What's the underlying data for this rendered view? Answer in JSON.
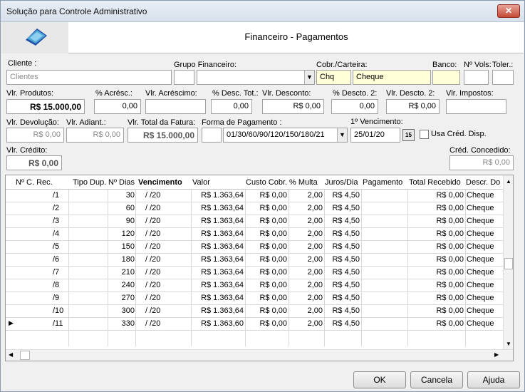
{
  "window": {
    "title": "Solução para Controle Administrativo",
    "close_icon": "close-icon"
  },
  "header": {
    "title": "Financeiro - Pagamentos"
  },
  "form": {
    "cliente_label": "Cliente :",
    "cliente_value": "Clientes",
    "grupo_label": "Grupo Financeiro:",
    "grupo_code": "",
    "grupo_value": "",
    "cobr_label": "Cobr./Carteira:",
    "cobr_code": "Chq",
    "cobr_value": "Cheque",
    "banco_label": "Banco:",
    "banco_value": "",
    "nvols_label": "Nº Vols:",
    "nvols_value": "",
    "toler_label": "Toler.:",
    "toler_value": "",
    "vlr_produtos_label": "Vlr. Produtos:",
    "vlr_produtos_value": "R$ 15.000,00",
    "acresc_pct_label": "% Acrésc.:",
    "acresc_pct_value": "0,00",
    "vlr_acrescimo_label": "Vlr. Acréscimo:",
    "vlr_acrescimo_value": "",
    "desc_tot_pct_label": "% Desc. Tot.:",
    "desc_tot_pct_value": "0,00",
    "vlr_desconto_label": "Vlr. Desconto:",
    "vlr_desconto_value": "R$ 0,00",
    "descto2_pct_label": "% Descto. 2:",
    "descto2_pct_value": "0,00",
    "vlr_descto2_label": "Vlr. Descto. 2:",
    "vlr_descto2_value": "R$ 0,00",
    "vlr_impostos_label": "Vlr. Impostos:",
    "vlr_impostos_value": "",
    "vlr_devolucao_label": "Vlr. Devolução:",
    "vlr_devolucao_value": "R$ 0,00",
    "vlr_adiant_label": "Vlr. Adiant.:",
    "vlr_adiant_value": "R$ 0,00",
    "vlr_total_label": "Vlr. Total da Fatura:",
    "vlr_total_value": "R$ 15.000,00",
    "forma_pgto_label": "Forma de Pagamento :",
    "forma_pgto_code": "",
    "forma_pgto_value": "01/30/60/90/120/150/180/21",
    "primeiro_venc_label": "1º Vencimento:",
    "primeiro_venc_value": "25/01/20",
    "calendar_label": "15",
    "usa_cred_label": "Usa Créd. Disp.",
    "vlr_credito_label": "Vlr. Crédito:",
    "vlr_credito_value": "R$ 0,00",
    "cred_concedido_label": "Créd. Concedido:",
    "cred_concedido_value": "R$ 0,00"
  },
  "grid": {
    "columns": [
      "Nº C. Rec.",
      "Tipo Dup.",
      "Nº Dias",
      "Vencimento",
      "Valor",
      "Custo Cobr.",
      "% Multa",
      "Juros/Dia",
      "Pagamento",
      "Total Recebido",
      "Descr. Do"
    ],
    "rows": [
      {
        "nrec": "/1",
        "tipo": "",
        "dias": "30",
        "venc": "/   /20",
        "valor": "R$ 1.363,64",
        "custo": "R$ 0,00",
        "multa": "2,00",
        "juros": "R$ 4,50",
        "pagamento": "",
        "total": "R$ 0,00",
        "descr": "Cheque"
      },
      {
        "nrec": "/2",
        "tipo": "",
        "dias": "60",
        "venc": "/   /20",
        "valor": "R$ 1.363,64",
        "custo": "R$ 0,00",
        "multa": "2,00",
        "juros": "R$ 4,50",
        "pagamento": "",
        "total": "R$ 0,00",
        "descr": "Cheque"
      },
      {
        "nrec": "/3",
        "tipo": "",
        "dias": "90",
        "venc": "/   /20",
        "valor": "R$ 1.363,64",
        "custo": "R$ 0,00",
        "multa": "2,00",
        "juros": "R$ 4,50",
        "pagamento": "",
        "total": "R$ 0,00",
        "descr": "Cheque"
      },
      {
        "nrec": "/4",
        "tipo": "",
        "dias": "120",
        "venc": "/   /20",
        "valor": "R$ 1.363,64",
        "custo": "R$ 0,00",
        "multa": "2,00",
        "juros": "R$ 4,50",
        "pagamento": "",
        "total": "R$ 0,00",
        "descr": "Cheque"
      },
      {
        "nrec": "/5",
        "tipo": "",
        "dias": "150",
        "venc": "/   /20",
        "valor": "R$ 1.363,64",
        "custo": "R$ 0,00",
        "multa": "2,00",
        "juros": "R$ 4,50",
        "pagamento": "",
        "total": "R$ 0,00",
        "descr": "Cheque"
      },
      {
        "nrec": "/6",
        "tipo": "",
        "dias": "180",
        "venc": "/   /20",
        "valor": "R$ 1.363,64",
        "custo": "R$ 0,00",
        "multa": "2,00",
        "juros": "R$ 4,50",
        "pagamento": "",
        "total": "R$ 0,00",
        "descr": "Cheque"
      },
      {
        "nrec": "/7",
        "tipo": "",
        "dias": "210",
        "venc": "/   /20",
        "valor": "R$ 1.363,64",
        "custo": "R$ 0,00",
        "multa": "2,00",
        "juros": "R$ 4,50",
        "pagamento": "",
        "total": "R$ 0,00",
        "descr": "Cheque"
      },
      {
        "nrec": "/8",
        "tipo": "",
        "dias": "240",
        "venc": "/   /20",
        "valor": "R$ 1.363,64",
        "custo": "R$ 0,00",
        "multa": "2,00",
        "juros": "R$ 4,50",
        "pagamento": "",
        "total": "R$ 0,00",
        "descr": "Cheque"
      },
      {
        "nrec": "/9",
        "tipo": "",
        "dias": "270",
        "venc": "/   /20",
        "valor": "R$ 1.363,64",
        "custo": "R$ 0,00",
        "multa": "2,00",
        "juros": "R$ 4,50",
        "pagamento": "",
        "total": "R$ 0,00",
        "descr": "Cheque"
      },
      {
        "nrec": "/10",
        "tipo": "",
        "dias": "300",
        "venc": "/   /20",
        "valor": "R$ 1.363,64",
        "custo": "R$ 0,00",
        "multa": "2,00",
        "juros": "R$ 4,50",
        "pagamento": "",
        "total": "R$ 0,00",
        "descr": "Cheque"
      },
      {
        "nrec": "/11",
        "tipo": "",
        "dias": "330",
        "venc": "/   /20",
        "valor": "R$ 1.363,60",
        "custo": "R$ 0,00",
        "multa": "2,00",
        "juros": "R$ 4,50",
        "pagamento": "",
        "total": "R$ 0,00",
        "descr": "Cheque"
      }
    ]
  },
  "buttons": {
    "ok": "OK",
    "cancel": "Cancela",
    "help": "Ajuda"
  }
}
